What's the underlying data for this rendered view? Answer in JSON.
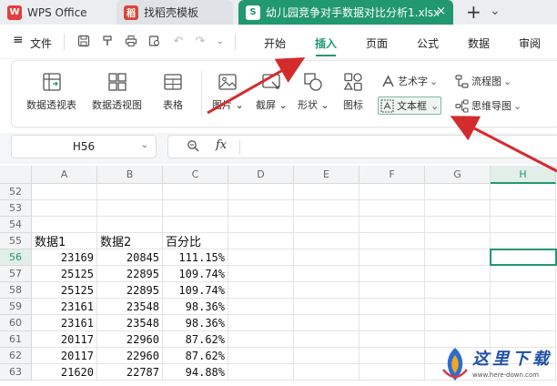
{
  "tabs": {
    "wps_office": "WPS Office",
    "find_template": "找稻壳模板",
    "active_file": "幼儿园竞争对手数据对比分析1.xlsx",
    "close_symbol": "×",
    "new_tab_symbol": "+",
    "more_symbol": "⌄"
  },
  "menubar": {
    "hamburger": "≡",
    "file": "文件",
    "items": [
      "开始",
      "插入",
      "页面",
      "公式",
      "数据",
      "审阅"
    ],
    "active_item": "插入",
    "accent_color": "#21986f"
  },
  "ribbon": {
    "pivot_table": "数据透视表",
    "pivot_chart": "数据透视图",
    "table": "表格",
    "picture": "图片",
    "screenshot": "截屏",
    "shapes": "形状",
    "icons": "图标",
    "wordart": "艺术字",
    "flowchart": "流程图",
    "textbox": "文本框",
    "mindmap": "思维导图"
  },
  "formula_bar": {
    "name_box": "H56",
    "fx_label": "fx",
    "formula_value": ""
  },
  "grid": {
    "columns": [
      "A",
      "B",
      "C",
      "D",
      "E",
      "F",
      "G",
      "H"
    ],
    "selected_column": "H",
    "rows": [
      {
        "num": "52",
        "cells": [
          "",
          "",
          ""
        ]
      },
      {
        "num": "53",
        "cells": [
          "",
          "",
          ""
        ]
      },
      {
        "num": "54",
        "cells": [
          "",
          "",
          ""
        ]
      },
      {
        "num": "55",
        "cells": [
          "数据1",
          "数据2",
          "百分比"
        ]
      },
      {
        "num": "56",
        "cells": [
          "23169",
          "20845",
          "111.15%"
        ]
      },
      {
        "num": "57",
        "cells": [
          "25125",
          "22895",
          "109.74%"
        ]
      },
      {
        "num": "58",
        "cells": [
          "25125",
          "22895",
          "109.74%"
        ]
      },
      {
        "num": "59",
        "cells": [
          "23161",
          "23548",
          "98.36%"
        ]
      },
      {
        "num": "60",
        "cells": [
          "23161",
          "23548",
          "98.36%"
        ]
      },
      {
        "num": "61",
        "cells": [
          "20117",
          "22960",
          "87.62%"
        ]
      },
      {
        "num": "62",
        "cells": [
          "20117",
          "22960",
          "87.62%"
        ]
      },
      {
        "num": "63",
        "cells": [
          "21620",
          "22787",
          "94.88%"
        ]
      }
    ],
    "selected_row": "56"
  },
  "watermark": {
    "brand": "这里下载",
    "url": "www.here-down.com"
  }
}
